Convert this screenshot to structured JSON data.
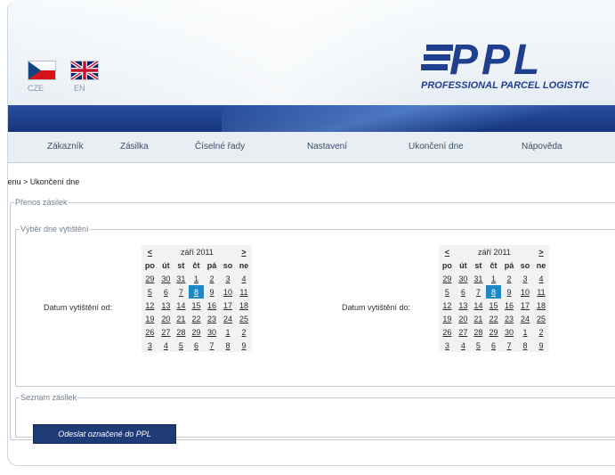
{
  "languages": [
    {
      "code": "CZE"
    },
    {
      "code": "EN"
    }
  ],
  "logo": {
    "word": "PPL",
    "tagline": "PROFESSIONAL PARCEL LOGISTIC",
    "reg": "®"
  },
  "menu": [
    "Zákazník",
    "Zásilka",
    "Číselné řady",
    "Nastavení",
    "Ukončení dne",
    "Nápověda"
  ],
  "breadcrumb": "menu > Ukončení dne",
  "sections": {
    "transfer": "Přenos zásilek",
    "date_select": "Výběr dne vytištění",
    "list": "Seznam zásilek"
  },
  "labels": {
    "date_from": "Datum vytištění od:",
    "date_to": "Datum vytištění do:"
  },
  "calendar": {
    "prev": "<",
    "next": ">",
    "month": "září 2011",
    "weekdays": [
      "po",
      "út",
      "st",
      "čt",
      "pá",
      "so",
      "ne"
    ],
    "weeks": [
      [
        "29",
        "30",
        "31",
        "1",
        "2",
        "3",
        "4"
      ],
      [
        "5",
        "6",
        "7",
        "8",
        "9",
        "10",
        "11"
      ],
      [
        "12",
        "13",
        "14",
        "15",
        "16",
        "17",
        "18"
      ],
      [
        "19",
        "20",
        "21",
        "22",
        "23",
        "24",
        "25"
      ],
      [
        "26",
        "27",
        "28",
        "29",
        "30",
        "1",
        "2"
      ],
      [
        "3",
        "4",
        "5",
        "6",
        "7",
        "8",
        "9"
      ]
    ],
    "selected": "8"
  },
  "button": "Odeslat označené do PPL",
  "colors": {
    "brand": "#1f3f8f",
    "band": "#17357e",
    "selected_day": "#1e88c6",
    "button": "#1e3b78"
  }
}
